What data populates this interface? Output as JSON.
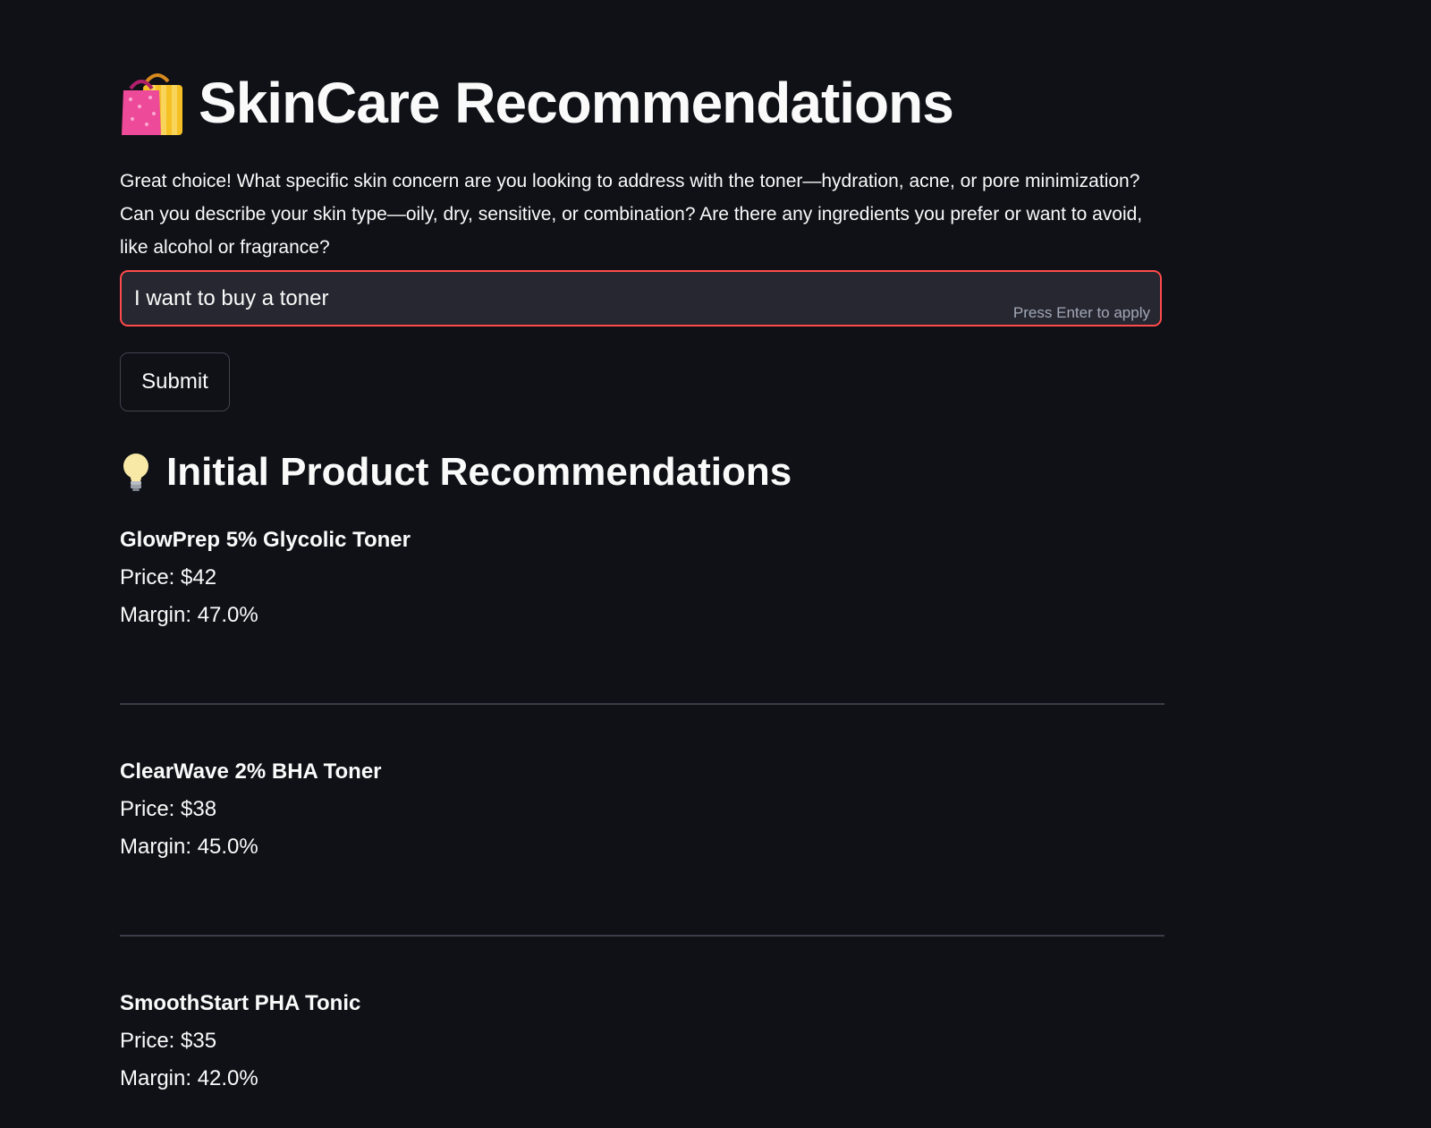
{
  "header": {
    "title": "SkinCare Recommendations",
    "icon": "shopping-bags-icon"
  },
  "assistant_prompt": "Great choice! What specific skin concern are you looking to address with the toner—hydration, acne, or pore minimization? Can you describe your skin type—oily, dry, sensitive, or combination? Are there any ingredients you prefer or want to avoid, like alcohol or fragrance?",
  "input": {
    "value": "I want to buy a toner",
    "hint": "Press Enter to apply"
  },
  "submit_label": "Submit",
  "recommendations": {
    "icon": "light-bulb-icon",
    "title": "Initial Product Recommendations",
    "products": [
      {
        "name": "GlowPrep 5% Glycolic Toner",
        "price": "Price: $42",
        "margin": "Margin: 47.0%"
      },
      {
        "name": "ClearWave 2% BHA Toner",
        "price": "Price: $38",
        "margin": "Margin: 45.0%"
      },
      {
        "name": "SmoothStart PHA Tonic",
        "price": "Price: $35",
        "margin": "Margin: 42.0%"
      }
    ]
  },
  "colors": {
    "background": "#0f1117",
    "input_background": "#262730",
    "input_focus_border": "#ff4b4b",
    "divider": "#3a3d47"
  }
}
